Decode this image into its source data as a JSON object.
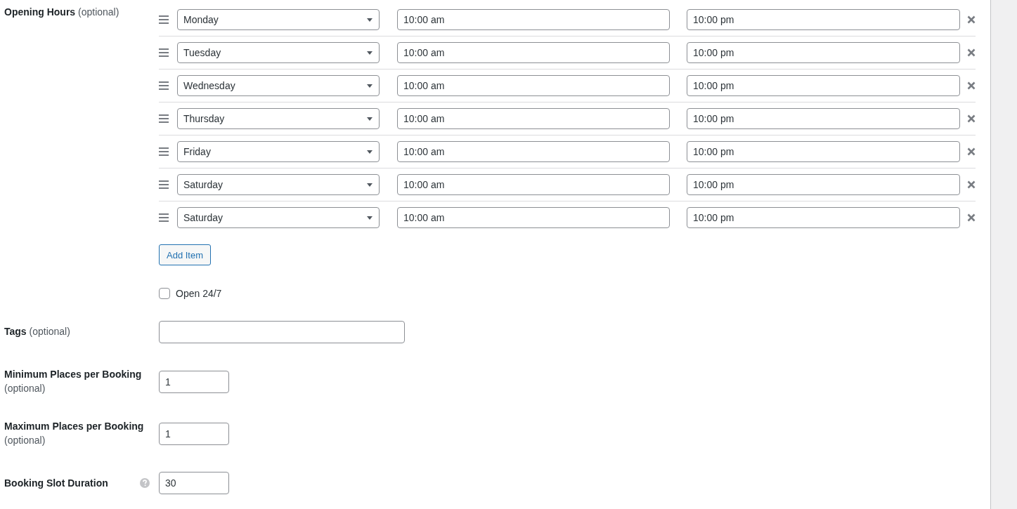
{
  "opening_hours": {
    "label": "Opening Hours",
    "hint": "(optional)",
    "rows": [
      {
        "day": "Monday",
        "open": "10:00 am",
        "close": "10:00 pm"
      },
      {
        "day": "Tuesday",
        "open": "10:00 am",
        "close": "10:00 pm"
      },
      {
        "day": "Wednesday",
        "open": "10:00 am",
        "close": "10:00 pm"
      },
      {
        "day": "Thursday",
        "open": "10:00 am",
        "close": "10:00 pm"
      },
      {
        "day": "Friday",
        "open": "10:00 am",
        "close": "10:00 pm"
      },
      {
        "day": "Saturday",
        "open": "10:00 am",
        "close": "10:00 pm"
      },
      {
        "day": "Saturday",
        "open": "10:00 am",
        "close": "10:00 pm"
      }
    ],
    "add_button": "Add Item",
    "open_24_7": {
      "label": "Open 24/7",
      "checked": false
    }
  },
  "fields": [
    {
      "kind": "text",
      "label": "Tags",
      "hint": "(optional)",
      "help": false
    },
    {
      "kind": "number",
      "label": "Minimum Places per Booking",
      "hint": "(optional)",
      "value": "1",
      "help": false
    },
    {
      "kind": "number",
      "label": "Maximum Places per Booking",
      "hint": "(optional)",
      "value": "1",
      "help": false
    },
    {
      "kind": "number",
      "label": "Booking Slot Duration",
      "value": "30",
      "help": true
    }
  ]
}
